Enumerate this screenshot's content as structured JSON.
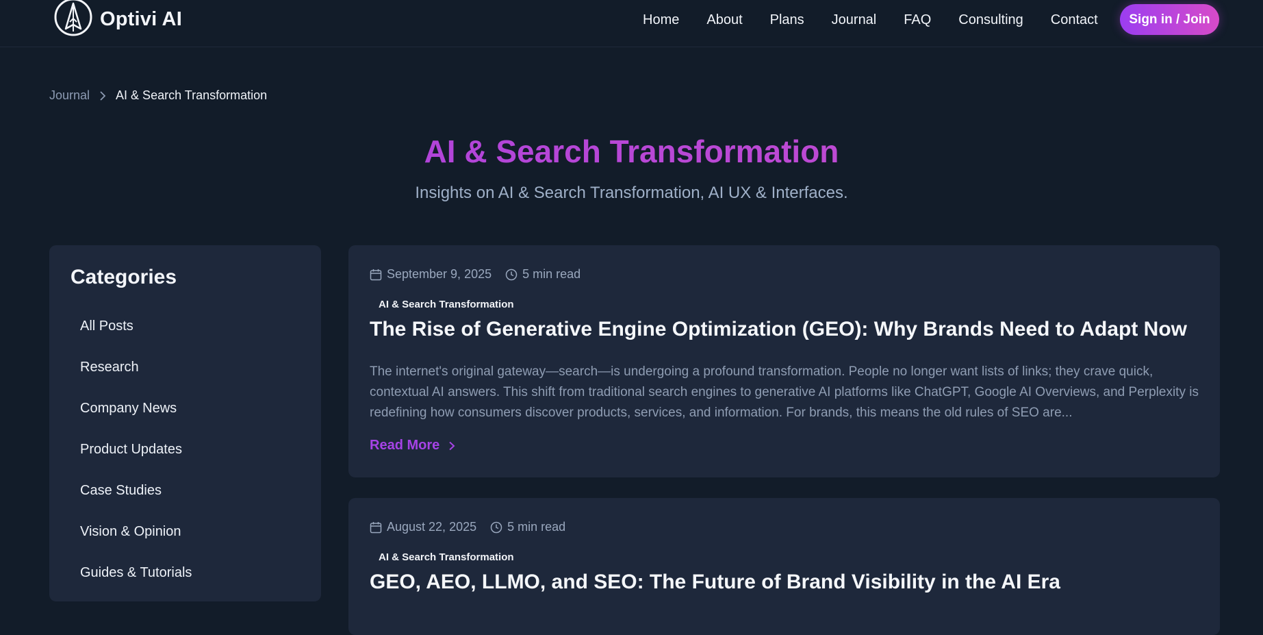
{
  "brand": {
    "name": "Optivi AI",
    "logo_icon": "compass-arrow-icon",
    "accent": "#a63fe0"
  },
  "nav": {
    "items": [
      "Home",
      "About",
      "Plans",
      "Journal",
      "FAQ",
      "Consulting",
      "Contact"
    ],
    "signin_label": "Sign in / Join"
  },
  "breadcrumb": {
    "parent": "Journal",
    "separator_icon": "chevron-right-icon",
    "current": "AI & Search Transformation"
  },
  "hero": {
    "title": "AI & Search Transformation",
    "subtitle": "Insights on AI & Search Transformation, AI UX & Interfaces."
  },
  "sidebar": {
    "heading": "Categories",
    "categories": [
      "All Posts",
      "Research",
      "Company News",
      "Product Updates",
      "Case Studies",
      "Vision & Opinion",
      "Guides & Tutorials"
    ]
  },
  "posts": [
    {
      "date": "September 9, 2025",
      "read_time": "5 min read",
      "tag": "AI & Search Transformation",
      "title": "The Rise of Generative Engine Optimization (GEO): Why Brands Need to Adapt Now",
      "excerpt": "The internet's original gateway—search—is undergoing a profound transformation. People no longer want lists of links; they crave quick, contextual AI answers. This shift from traditional search engines to generative AI platforms like ChatGPT, Google AI Overviews, and Perplexity is redefining how consumers discover products, services, and information. For brands, this means the old rules of SEO are...",
      "read_more": "Read More"
    },
    {
      "date": "August 22, 2025",
      "read_time": "5 min read",
      "tag": "AI & Search Transformation",
      "title": "GEO, AEO, LLMO, and SEO: The Future of Brand Visibility in the AI Era"
    }
  ]
}
